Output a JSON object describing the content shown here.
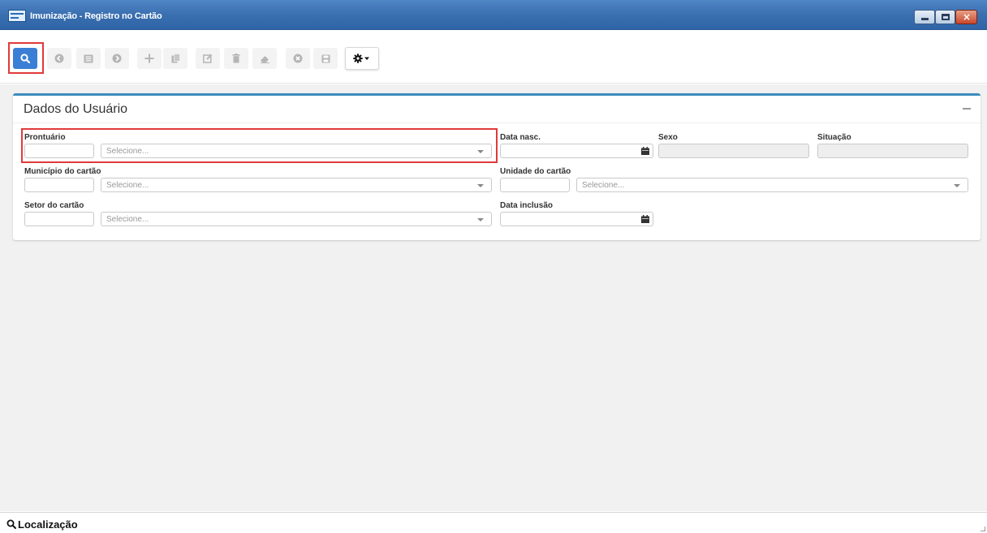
{
  "window": {
    "title": "Imunização - Registro no Cartão",
    "close_glyph": "×"
  },
  "toolbar": {
    "buttons": [
      {
        "name": "search-icon",
        "state": "active"
      },
      {
        "name": "arrow-left-icon",
        "state": "disabled"
      },
      {
        "name": "list-icon",
        "state": "disabled"
      },
      {
        "name": "arrow-right-icon",
        "state": "disabled"
      },
      {
        "name": "plus-icon",
        "state": "disabled"
      },
      {
        "name": "copy-icon",
        "state": "disabled"
      },
      {
        "name": "edit-icon",
        "state": "disabled"
      },
      {
        "name": "trash-icon",
        "state": "disabled"
      },
      {
        "name": "eraser-icon",
        "state": "disabled"
      },
      {
        "name": "cancel-icon",
        "state": "disabled"
      },
      {
        "name": "save-icon",
        "state": "disabled"
      },
      {
        "name": "gear-dropdown-icon",
        "state": "enabled"
      }
    ]
  },
  "panel": {
    "title": "Dados do Usuário",
    "fields": {
      "prontuario": {
        "label": "Prontuário",
        "code_value": "",
        "select_placeholder": "Selecione..."
      },
      "data_nasc": {
        "label": "Data nasc.",
        "value": ""
      },
      "sexo": {
        "label": "Sexo",
        "value": ""
      },
      "situacao": {
        "label": "Situação",
        "value": ""
      },
      "municipio": {
        "label": "Município do cartão",
        "code_value": "",
        "select_placeholder": "Selecione..."
      },
      "unidade": {
        "label": "Unidade do cartão",
        "code_value": "",
        "select_placeholder": "Selecione..."
      },
      "setor": {
        "label": "Setor do cartão",
        "code_value": "",
        "select_placeholder": "Selecione..."
      },
      "data_inclusao": {
        "label": "Data inclusão",
        "value": ""
      }
    }
  },
  "footer": {
    "label": "Localização"
  },
  "colors": {
    "accent": "#3a7fd5",
    "panel_border": "#3c8dbc",
    "highlight": "#e03a3a",
    "titlebar": "#3a6fb0"
  }
}
